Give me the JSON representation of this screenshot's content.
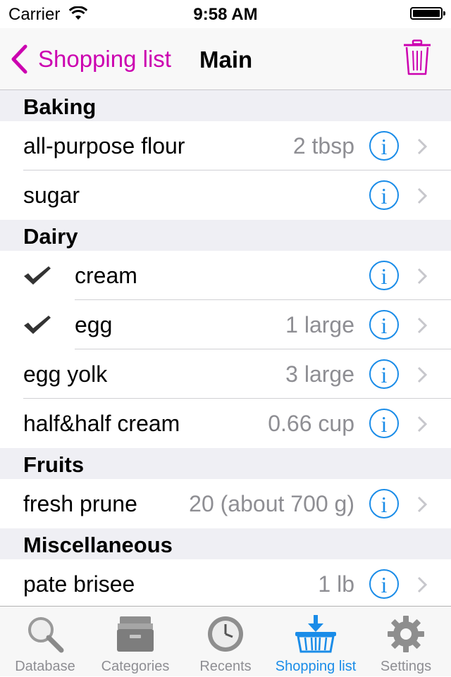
{
  "status": {
    "carrier": "Carrier",
    "time": "9:58 AM"
  },
  "nav": {
    "back_label": "Shopping list",
    "title": "Main"
  },
  "sections": [
    {
      "title": "Baking",
      "items": [
        {
          "name": "all-purpose flour",
          "qty": "2 tbsp",
          "checked": false
        },
        {
          "name": "sugar",
          "qty": "",
          "checked": false
        }
      ]
    },
    {
      "title": "Dairy",
      "items": [
        {
          "name": "cream",
          "qty": "",
          "checked": true
        },
        {
          "name": "egg",
          "qty": "1 large",
          "checked": true
        },
        {
          "name": "egg yolk",
          "qty": "3 large",
          "checked": false
        },
        {
          "name": "half&half cream",
          "qty": "0.66 cup",
          "checked": false
        }
      ]
    },
    {
      "title": "Fruits",
      "items": [
        {
          "name": "fresh prune",
          "qty": "20 (about 700 g)",
          "checked": false
        }
      ]
    },
    {
      "title": "Miscellaneous",
      "items": [
        {
          "name": "pate brisee",
          "qty": "1 lb",
          "checked": false
        }
      ]
    }
  ],
  "tabs": [
    {
      "label": "Database",
      "icon": "magnifier-icon",
      "active": false
    },
    {
      "label": "Categories",
      "icon": "drawer-icon",
      "active": false
    },
    {
      "label": "Recents",
      "icon": "clock-icon",
      "active": false
    },
    {
      "label": "Shopping list",
      "icon": "basket-icon",
      "active": true
    },
    {
      "label": "Settings",
      "icon": "gear-icon",
      "active": false
    }
  ],
  "colors": {
    "accent": "#cc00b0",
    "info_blue": "#1a8ce8",
    "section_bg": "#efeff4",
    "secondary_text": "#8e8e93"
  }
}
